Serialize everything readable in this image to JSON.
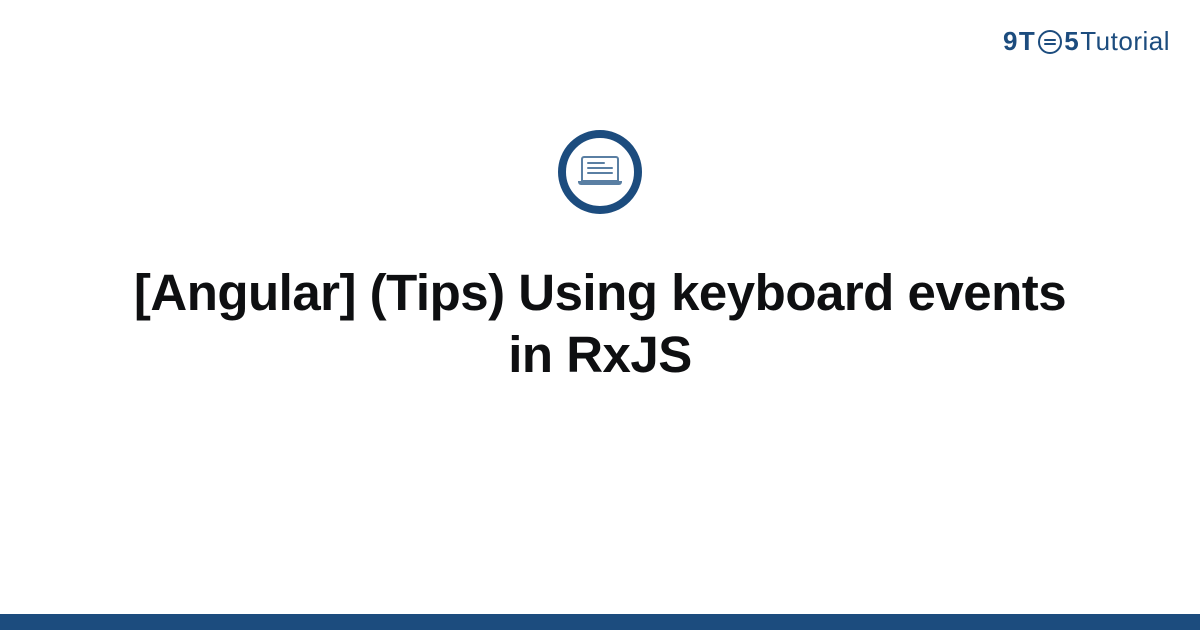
{
  "logo": {
    "nine": "9",
    "t": "T",
    "five": "5",
    "tutorial": "Tutorial"
  },
  "icon": {
    "name": "laptop-icon"
  },
  "title": "[Angular] (Tips) Using keyboard events in RxJS",
  "colors": {
    "brand": "#1c4c7e",
    "iconStroke": "#5a7fa3",
    "text": "#0e0f11"
  }
}
